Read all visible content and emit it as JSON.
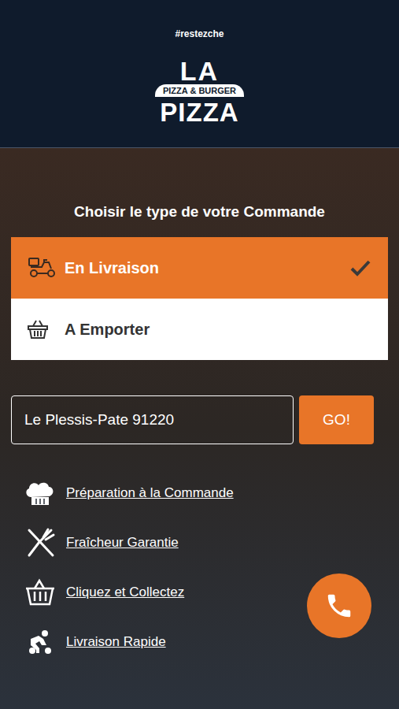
{
  "header": {
    "hashtag": "#restezche",
    "logo": {
      "top": "LA",
      "banner": "PIZZA & BURGER",
      "bottom": "PIZZA"
    }
  },
  "title": "Choisir le type de votre Commande",
  "order_types": [
    {
      "label": "En Livraison",
      "selected": true,
      "kind": "delivery"
    },
    {
      "label": "A Emporter",
      "selected": false,
      "kind": "takeaway"
    }
  ],
  "address": {
    "value": "Le Plessis-Pate 91220"
  },
  "go_button": "GO!",
  "features": [
    {
      "label": "Préparation à la Commande",
      "kind": "chef"
    },
    {
      "label": "Fraîcheur Garantie",
      "kind": "cutlery"
    },
    {
      "label": "Cliquez et Collectez",
      "kind": "basket"
    },
    {
      "label": "Livraison Rapide",
      "kind": "scooter"
    }
  ]
}
